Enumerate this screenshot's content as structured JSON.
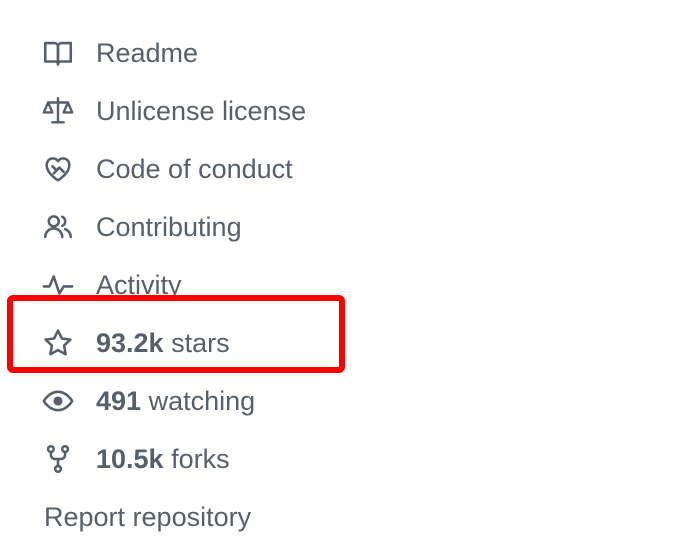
{
  "links": {
    "readme": "Readme",
    "license": "Unlicense license",
    "code_of_conduct": "Code of conduct",
    "contributing": "Contributing",
    "activity": "Activity"
  },
  "stats": {
    "stars_count": "93.2k",
    "stars_label": " stars",
    "watching_count": "491",
    "watching_label": " watching",
    "forks_count": "10.5k",
    "forks_label": " forks"
  },
  "report": {
    "label": "Report repository"
  },
  "icons": {
    "readme": "book-icon",
    "license": "law-scale-icon",
    "code_of_conduct": "heart-handshake-icon",
    "contributing": "people-icon",
    "activity": "pulse-icon",
    "stars": "star-icon",
    "watching": "eye-icon",
    "forks": "repo-forked-icon"
  },
  "colors": {
    "text": "#57606a",
    "highlight": "#ff0000"
  }
}
